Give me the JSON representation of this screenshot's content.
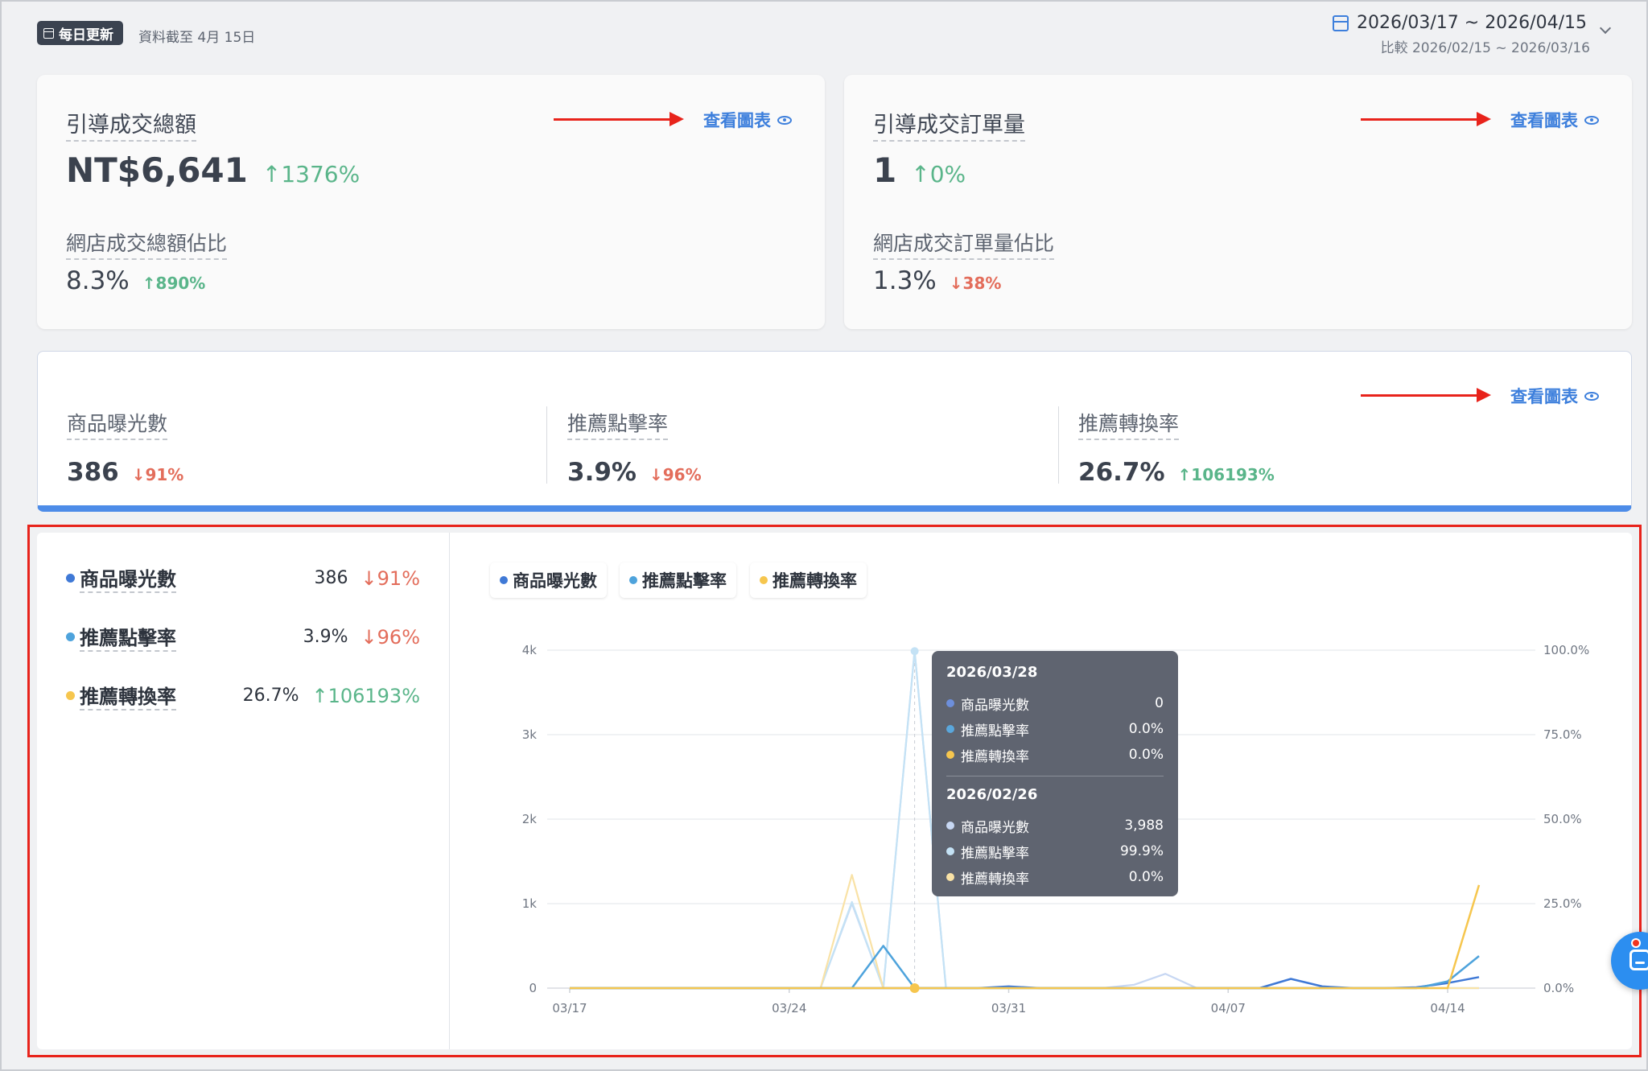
{
  "header": {
    "badge_label": "每日更新",
    "as_of": "資料截至 4月 15日",
    "date_range": "2026/03/17 ~ 2026/04/15",
    "compare_range": "比較 2026/02/15 ~ 2026/03/16"
  },
  "cards": [
    {
      "title": "引導成交總額",
      "value": "NT$6,641",
      "delta": "↑1376%",
      "sub_title": "網店成交總額佔比",
      "sub_value": "8.3%",
      "sub_delta": "↑890%",
      "view_chart": "查看圖表"
    },
    {
      "title": "引導成交訂單量",
      "value": "1",
      "delta": "↑0%",
      "sub_title": "網店成交訂單量佔比",
      "sub_value": "1.3%",
      "sub_delta": "↓38%",
      "view_chart": "查看圖表"
    }
  ],
  "metrics_strip": {
    "view_chart": "查看圖表",
    "items": [
      {
        "label": "商品曝光數",
        "value": "386",
        "delta": "↓91%"
      },
      {
        "label": "推薦點擊率",
        "value": "3.9%",
        "delta": "↓96%"
      },
      {
        "label": "推薦轉換率",
        "value": "26.7%",
        "delta": "↑106193%"
      }
    ]
  },
  "chart_panel": {
    "summary": [
      {
        "label": "商品曝光數",
        "value": "386",
        "delta": "↓91%",
        "color": "#3f79d6"
      },
      {
        "label": "推薦點擊率",
        "value": "3.9%",
        "delta": "↓96%",
        "color": "#4ea3dc"
      },
      {
        "label": "推薦轉換率",
        "value": "26.7%",
        "delta": "↑106193%",
        "color": "#f6c64e"
      }
    ],
    "legend": [
      {
        "label": "商品曝光數",
        "color": "#3f79d6"
      },
      {
        "label": "推薦點擊率",
        "color": "#4ea3dc"
      },
      {
        "label": "推薦轉換率",
        "color": "#f6c64e"
      }
    ],
    "tooltip": {
      "current_date": "2026/03/28",
      "current": [
        {
          "label": "商品曝光數",
          "value": "0",
          "color": "#6d8fdc"
        },
        {
          "label": "推薦點擊率",
          "value": "0.0%",
          "color": "#5aa7dc"
        },
        {
          "label": "推薦轉換率",
          "value": "0.0%",
          "color": "#f6c64e"
        }
      ],
      "previous_date": "2026/02/26",
      "previous": [
        {
          "label": "商品曝光數",
          "value": "3,988",
          "color": "#c7d7f3"
        },
        {
          "label": "推薦點擊率",
          "value": "99.9%",
          "color": "#c4e2f5"
        },
        {
          "label": "推薦轉換率",
          "value": "0.0%",
          "color": "#f9e2a6"
        }
      ]
    }
  },
  "chart_data": {
    "type": "line",
    "x": [
      "03/17",
      "03/18",
      "03/19",
      "03/20",
      "03/21",
      "03/22",
      "03/23",
      "03/24",
      "03/25",
      "03/26",
      "03/27",
      "03/28",
      "03/29",
      "03/30",
      "03/31",
      "04/01",
      "04/02",
      "04/03",
      "04/04",
      "04/05",
      "04/06",
      "04/07",
      "04/08",
      "04/09",
      "04/10",
      "04/11",
      "04/12",
      "04/13",
      "04/14",
      "04/15"
    ],
    "x_tick_labels": [
      "03/17",
      "03/24",
      "03/31",
      "04/07",
      "04/14"
    ],
    "y_left_ticks": [
      "0",
      "1k",
      "2k",
      "3k",
      "4k"
    ],
    "y_left_range": [
      0,
      4000
    ],
    "y_right_ticks": [
      "0.0%",
      "25.0%",
      "50.0%",
      "75.0%",
      "100.0%"
    ],
    "y_right_range": [
      0,
      100
    ],
    "series": [
      {
        "name": "商品曝光數",
        "axis": "left",
        "color": "#3f79d6",
        "values": [
          0,
          0,
          0,
          0,
          0,
          0,
          0,
          0,
          0,
          0,
          0,
          0,
          0,
          0,
          20,
          0,
          0,
          0,
          0,
          0,
          0,
          0,
          0,
          110,
          20,
          0,
          0,
          10,
          60,
          130
        ]
      },
      {
        "name": "推薦點擊率",
        "axis": "right",
        "color": "#4ea3dc",
        "values": [
          0,
          0,
          0,
          0,
          0,
          0,
          0,
          0,
          0,
          0,
          12.5,
          0,
          0,
          0,
          0,
          0,
          0,
          0,
          0,
          0,
          0,
          0,
          0,
          0,
          0,
          0,
          0,
          0,
          2,
          9.5
        ]
      },
      {
        "name": "推薦轉換率",
        "axis": "right",
        "color": "#f6c64e",
        "values": [
          0,
          0,
          0,
          0,
          0,
          0,
          0,
          0,
          0,
          0,
          0,
          0,
          0,
          0,
          0,
          0,
          0,
          0,
          0,
          0,
          0,
          0,
          0,
          0,
          0,
          0,
          0,
          0,
          0,
          30.5
        ]
      },
      {
        "name": "商品曝光數 (比較期)",
        "axis": "left",
        "color": "#c7d7f3",
        "values": [
          0,
          0,
          0,
          0,
          0,
          0,
          0,
          0,
          0,
          1000,
          0,
          3988,
          0,
          0,
          0,
          0,
          0,
          0,
          40,
          170,
          0,
          0,
          0,
          0,
          0,
          0,
          0,
          0,
          0,
          0
        ]
      },
      {
        "name": "推薦點擊率 (比較期)",
        "axis": "right",
        "color": "#c4e2f5",
        "values": [
          0,
          0,
          0,
          0,
          0,
          0,
          0,
          0,
          0,
          25.5,
          0,
          99.9,
          0,
          0,
          0,
          0,
          0,
          0,
          0,
          0,
          0,
          0,
          0,
          0,
          0,
          0,
          0,
          0,
          0,
          0
        ]
      },
      {
        "name": "推薦轉換率 (比較期)",
        "axis": "right",
        "color": "#f9e2a6",
        "values": [
          0,
          0,
          0,
          0,
          0,
          0,
          0,
          0,
          0,
          33.5,
          0,
          0,
          0,
          0,
          0,
          0,
          0,
          0,
          0,
          0,
          0,
          0,
          0,
          0,
          0,
          0,
          0,
          0,
          0,
          0
        ]
      }
    ],
    "hover_index": 11,
    "grid": true,
    "legend_position": "top-left"
  }
}
